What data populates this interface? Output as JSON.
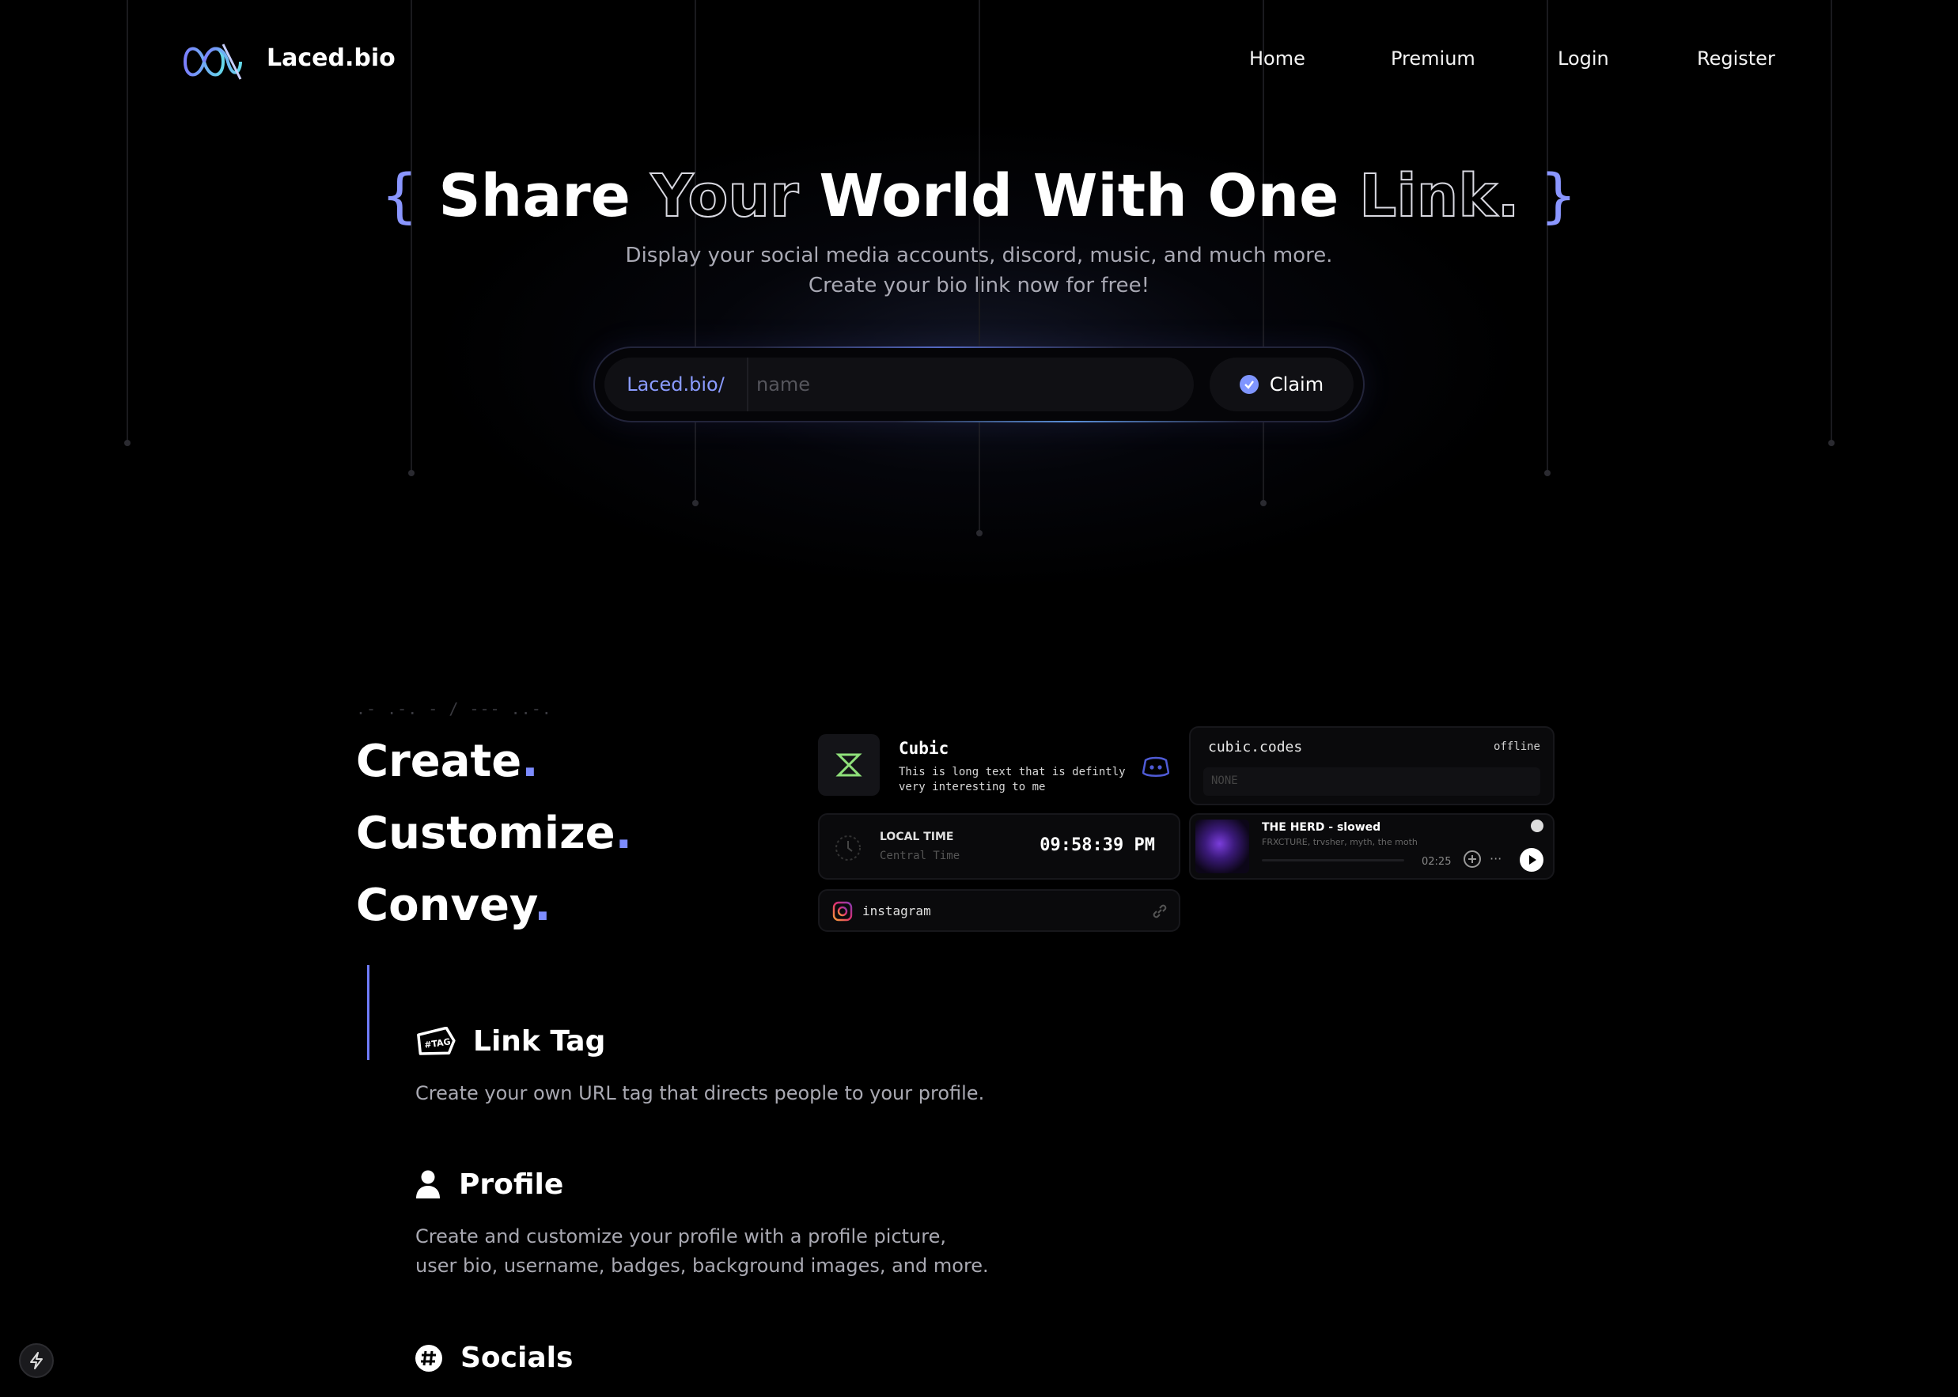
{
  "nav": {
    "brand": "Laced.bio",
    "links": [
      "Home",
      "Premium",
      "Login",
      "Register"
    ]
  },
  "hero": {
    "brace_open": "{",
    "brace_close": "}",
    "word1": "Share",
    "word2": "Your",
    "word3": "World",
    "word4": "With",
    "word5": "One",
    "word6": "Link.",
    "subtitle_line1": "Display your social media accounts, discord, music, and much more.",
    "subtitle_line2": "Create your bio link now for free!",
    "claim": {
      "prefix": "Laced.bio/",
      "placeholder": "name",
      "button_label": "Claim"
    }
  },
  "section": {
    "kicker": ".- .-. - / --- ..-.",
    "headline1": "Create",
    "headline2": "Customize",
    "headline3": "Convey",
    "dot": "."
  },
  "preview": {
    "profile": {
      "name": "Cubic",
      "bio_line1": "This is long text that is defintly",
      "bio_line2": "very interesting to me"
    },
    "discord": {
      "username": "cubic.codes",
      "status": "offline",
      "activity": "NONE"
    },
    "time": {
      "label": "LOCAL TIME",
      "zone": "Central Time",
      "value": "09:58:39 PM"
    },
    "music": {
      "title": "THE HERD - slowed",
      "artists": "FRXCTURE, trvsher, myth, the moth",
      "elapsed": "02:25",
      "more": "···"
    },
    "social": {
      "label": "instagram"
    }
  },
  "features": [
    {
      "title": "Link Tag",
      "icon": "tag-icon",
      "desc_line1": "Create your own URL tag that directs people to your profile.",
      "desc_line2": ""
    },
    {
      "title": "Profile",
      "icon": "user-icon",
      "desc_line1": "Create and customize your profile with a profile picture,",
      "desc_line2": "user bio, username, badges, background images, and more."
    },
    {
      "title": "Socials",
      "icon": "hash-icon",
      "desc_line1": "",
      "desc_line2": ""
    }
  ],
  "colors": {
    "accent": "#7d8cff",
    "background": "#000000",
    "muted_text": "#a9a9b2"
  }
}
